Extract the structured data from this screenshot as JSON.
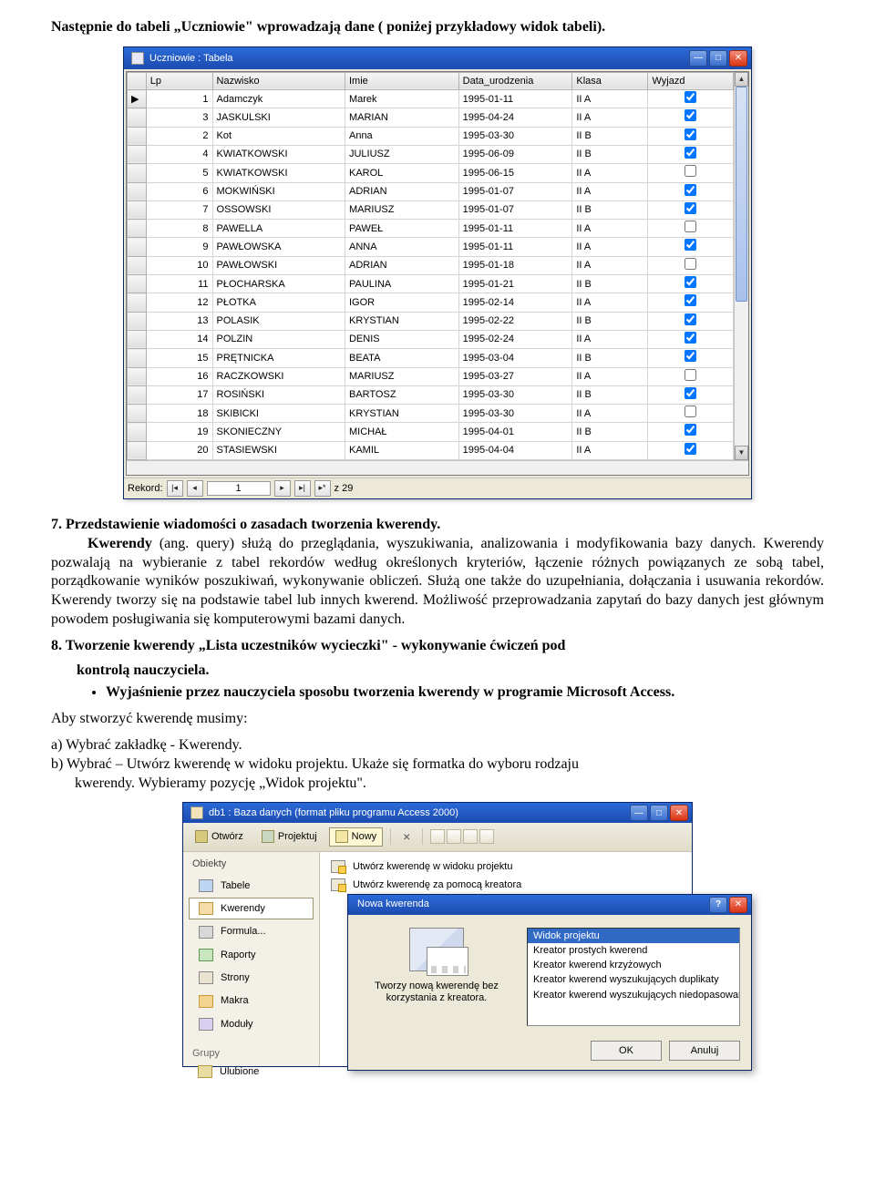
{
  "intro": "Następnie do tabeli „Uczniowie\" wprowadzają dane ( poniżej przykładowy widok tabeli).",
  "table_window": {
    "title": "Uczniowie : Tabela",
    "columns": [
      "Lp",
      "Nazwisko",
      "Imie",
      "Data_urodzenia",
      "Klasa",
      "Wyjazd"
    ],
    "rows": [
      {
        "lp": 1,
        "nazwisko": "Adamczyk",
        "imie": "Marek",
        "data": "1995-01-11",
        "klasa": "II A",
        "wyjazd": true,
        "current": true
      },
      {
        "lp": 3,
        "nazwisko": "JASKULSKI",
        "imie": "MARIAN",
        "data": "1995-04-24",
        "klasa": "II A",
        "wyjazd": true
      },
      {
        "lp": 2,
        "nazwisko": "Kot",
        "imie": "Anna",
        "data": "1995-03-30",
        "klasa": "II B",
        "wyjazd": true
      },
      {
        "lp": 4,
        "nazwisko": "KWIATKOWSKI",
        "imie": "JULIUSZ",
        "data": "1995-06-09",
        "klasa": "II B",
        "wyjazd": true
      },
      {
        "lp": 5,
        "nazwisko": "KWIATKOWSKI",
        "imie": "KAROL",
        "data": "1995-06-15",
        "klasa": "II A",
        "wyjazd": false
      },
      {
        "lp": 6,
        "nazwisko": "MOKWIŃSKI",
        "imie": "ADRIAN",
        "data": "1995-01-07",
        "klasa": "II A",
        "wyjazd": true
      },
      {
        "lp": 7,
        "nazwisko": "OSSOWSKI",
        "imie": "MARIUSZ",
        "data": "1995-01-07",
        "klasa": "II B",
        "wyjazd": true
      },
      {
        "lp": 8,
        "nazwisko": "PAWELLA",
        "imie": "PAWEŁ",
        "data": "1995-01-11",
        "klasa": "II A",
        "wyjazd": false
      },
      {
        "lp": 9,
        "nazwisko": "PAWŁOWSKA",
        "imie": "ANNA",
        "data": "1995-01-11",
        "klasa": "II A",
        "wyjazd": true
      },
      {
        "lp": 10,
        "nazwisko": "PAWŁOWSKI",
        "imie": "ADRIAN",
        "data": "1995-01-18",
        "klasa": "II A",
        "wyjazd": false
      },
      {
        "lp": 11,
        "nazwisko": "PŁOCHARSKA",
        "imie": "PAULINA",
        "data": "1995-01-21",
        "klasa": "II B",
        "wyjazd": true
      },
      {
        "lp": 12,
        "nazwisko": "PŁOTKA",
        "imie": "IGOR",
        "data": "1995-02-14",
        "klasa": "II A",
        "wyjazd": true
      },
      {
        "lp": 13,
        "nazwisko": "POLASIK",
        "imie": "KRYSTIAN",
        "data": "1995-02-22",
        "klasa": "II B",
        "wyjazd": true
      },
      {
        "lp": 14,
        "nazwisko": "POLZIN",
        "imie": "DENIS",
        "data": "1995-02-24",
        "klasa": "II A",
        "wyjazd": true
      },
      {
        "lp": 15,
        "nazwisko": "PRĘTNICKA",
        "imie": "BEATA",
        "data": "1995-03-04",
        "klasa": "II B",
        "wyjazd": true
      },
      {
        "lp": 16,
        "nazwisko": "RACZKOWSKI",
        "imie": "MARIUSZ",
        "data": "1995-03-27",
        "klasa": "II A",
        "wyjazd": false
      },
      {
        "lp": 17,
        "nazwisko": "ROSIŃSKI",
        "imie": "BARTOSZ",
        "data": "1995-03-30",
        "klasa": "II B",
        "wyjazd": true
      },
      {
        "lp": 18,
        "nazwisko": "SKIBICKI",
        "imie": "KRYSTIAN",
        "data": "1995-03-30",
        "klasa": "II A",
        "wyjazd": false
      },
      {
        "lp": 19,
        "nazwisko": "SKONIECZNY",
        "imie": "MICHAŁ",
        "data": "1995-04-01",
        "klasa": "II B",
        "wyjazd": true
      },
      {
        "lp": 20,
        "nazwisko": "STASIEWSKI",
        "imie": "KAMIL",
        "data": "1995-04-04",
        "klasa": "II A",
        "wyjazd": true
      }
    ],
    "nav": {
      "label": "Rekord:",
      "current": "1",
      "of": "z 29"
    }
  },
  "section7": {
    "heading": "7. Przedstawienie wiadomości o zasadach tworzenia kwerendy.",
    "boldlead": "Kwerendy",
    "para": " (ang. query) służą do przeglądania, wyszukiwania, analizowania i modyfikowania bazy danych. Kwerendy pozwalają na wybieranie z tabel rekordów według określonych kryteriów, łączenie różnych powiązanych ze sobą tabel, porządkowanie wyników poszukiwań, wykonywanie obliczeń. Służą one także do uzupełniania, dołączania i usuwania rekordów. Kwerendy tworzy się na podstawie tabel lub innych kwerend. Możliwość przeprowadzania zapytań do bazy danych jest głównym powodem posługiwania się komputerowymi bazami danych."
  },
  "section8": {
    "heading_l1": "8. Tworzenie kwerendy „Lista uczestników wycieczki\" - wykonywanie ćwiczeń pod",
    "heading_l2": "kontrolą nauczyciela.",
    "bullet1": "Wyjaśnienie przez nauczyciela sposobu tworzenia kwerendy w programie Microsoft Access."
  },
  "steps": {
    "lead": "Aby stworzyć kwerendę musimy:",
    "a": "a) Wybrać zakładkę - Kwerendy.",
    "b": "b) Wybrać – Utwórz kwerendę w widoku projektu. Ukaże się formatka do wyboru rodzaju",
    "b2": "kwerendy. Wybieramy pozycję „Widok projektu\"."
  },
  "db_window": {
    "title": "db1 : Baza danych (format pliku programu Access 2000)",
    "toolbar": {
      "open": "Otwórz",
      "design": "Projektuj",
      "new": "Nowy",
      "delete_icon": "×"
    },
    "nav": {
      "objects": "Obiekty",
      "items": [
        "Tabele",
        "Kwerendy",
        "Formula...",
        "Raporty",
        "Strony",
        "Makra",
        "Moduły"
      ],
      "selected": 1,
      "groups": "Grupy",
      "fav": "Ulubione"
    },
    "content": {
      "item1": "Utwórz kwerendę w widoku projektu",
      "item2": "Utwórz kwerendę za pomocą kreatora"
    }
  },
  "dialog": {
    "title": "Nowa kwerenda",
    "desc": "Tworzy nową kwerendę bez korzystania z kreatora.",
    "options": [
      "Widok projektu",
      "Kreator prostych kwerend",
      "Kreator kwerend krzyżowych",
      "Kreator kwerend wyszukujących duplikaty",
      "Kreator kwerend wyszukujących niedopasowane dane"
    ],
    "ok": "OK",
    "cancel": "Anuluj"
  }
}
